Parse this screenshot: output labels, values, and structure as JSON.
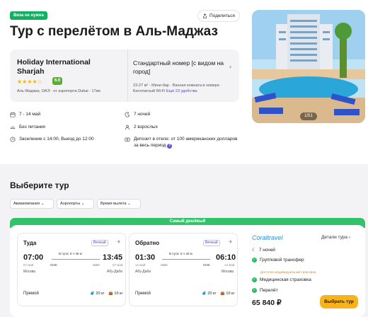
{
  "badge": "Виза не нужна",
  "title": "Тур с перелётом в Аль-Маджаз",
  "share_label": "Поделиться",
  "photo_counter": "1/51",
  "hotel": {
    "name": "Holiday International Sharjah",
    "stars": 4,
    "stars_text": "★★★★☆",
    "rating": "6.6",
    "location": "Аль-Маджаз, ОАЭ · от аэропорта Dubai - 17км"
  },
  "room": {
    "name": "Стандартный номер [с видом на город]",
    "features": "23-27 м² · Мини-бар · Ванная комната в номере · Бесплатный Wi-Fi",
    "more_link": "Ещё 23 удобства"
  },
  "features": {
    "dates": "7 - 14 май",
    "nights": "7 ночей",
    "food": "Без питания",
    "guests": "2 взрослых",
    "checkin": "Заселение с 14:00, Выезд до 12:00",
    "deposit": "Депозит в отеле: от 100 американских долларов за весь период"
  },
  "choose_title": "Выберите тур",
  "filters": [
    "Авиакомпания",
    "Аэропорты",
    "Время вылета"
  ],
  "best_label": "Самый дешёвый",
  "outbound": {
    "title": "Туда",
    "tag": "Вечный",
    "dep_time": "07:00",
    "dep_date": "07 май",
    "dep_city": "Москва",
    "dep_code": "DME",
    "duration": "В пути: 5 ч 45 м",
    "arr_code": "AUH",
    "arr_time": "13:45",
    "arr_date": "07 май",
    "arr_city": "Абу-Даби",
    "class": "Премой",
    "bag1": "20 кг",
    "bag2": "10 кг"
  },
  "inbound": {
    "title": "Обратно",
    "tag": "Вечный",
    "dep_time": "01:30",
    "dep_date": "14 май",
    "dep_city": "Абу-Даби",
    "dep_code": "AUH",
    "duration": "В пути: 5 ч 40 м",
    "arr_code": "DME",
    "arr_time": "06:10",
    "arr_date": "14 май",
    "arr_city": "Москва",
    "class": "Премой",
    "bag1": "20 кг",
    "bag2": "10 кг"
  },
  "operator": {
    "name": "Coraltravel",
    "details": "Детали тура",
    "nights": "7 ночей",
    "transfer": "Групповой трансфер",
    "transfer_note": "Доступен индивидуальный трансфер",
    "insurance": "Медицинская страховка",
    "flight": "Перелёт",
    "price": "65 840 ₽",
    "button": "Выбрать тур"
  }
}
